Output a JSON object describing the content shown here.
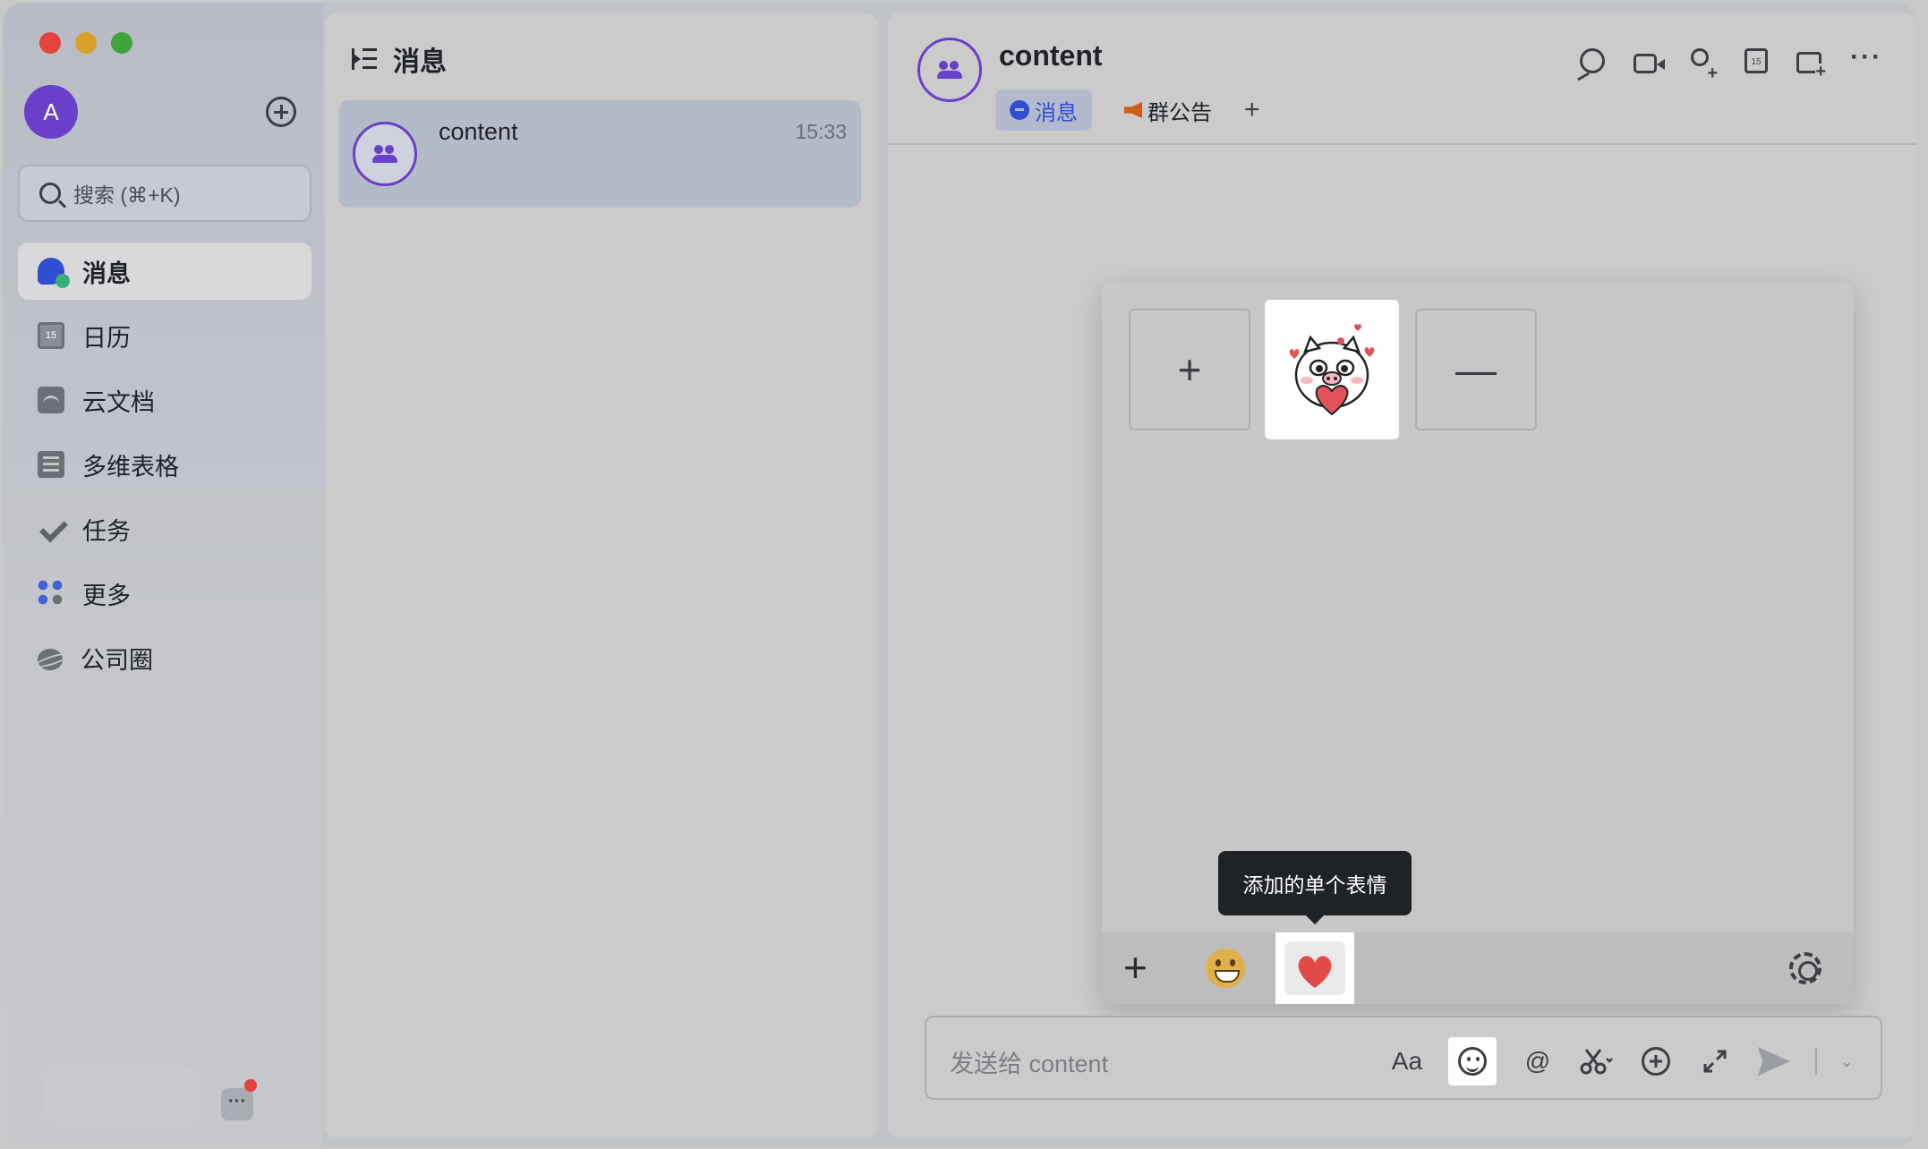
{
  "sidebar": {
    "avatar_letter": "A",
    "search_placeholder": "搜索 (⌘+K)",
    "items": [
      {
        "label": "消息",
        "icon": "message-icon"
      },
      {
        "label": "日历",
        "icon": "calendar-icon"
      },
      {
        "label": "云文档",
        "icon": "docs-icon"
      },
      {
        "label": "多维表格",
        "icon": "table-icon"
      },
      {
        "label": "任务",
        "icon": "task-icon"
      },
      {
        "label": "更多",
        "icon": "apps-icon"
      },
      {
        "label": "公司圈",
        "icon": "planet-icon"
      }
    ],
    "more_glyph": "···"
  },
  "list": {
    "title": "消息",
    "conversations": [
      {
        "name": "content",
        "time": "15:33"
      }
    ]
  },
  "chat": {
    "title": "content",
    "tabs": [
      {
        "label": "消息",
        "active": true
      },
      {
        "label": "群公告",
        "active": false
      }
    ],
    "tab_add": "+",
    "more_glyph": "···",
    "input_placeholder": "发送给 content",
    "format_label": "Aa",
    "mention_label": "@"
  },
  "emoji_panel": {
    "add_slot": "+",
    "remove_slot": "—",
    "tooltip": "添加的单个表情",
    "bottom_plus": "+"
  },
  "colors": {
    "accent": "#2f4ed1",
    "avatar": "#6a3fc9",
    "close": "#e0443a",
    "minimize": "#d9a02a",
    "zoom": "#3ea53b"
  }
}
